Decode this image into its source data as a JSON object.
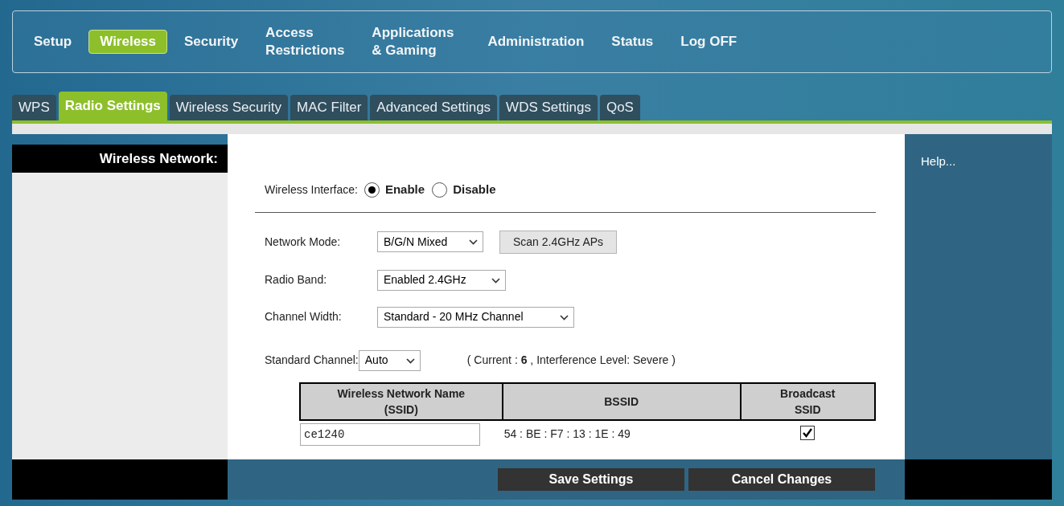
{
  "main_nav": [
    {
      "label": "Setup",
      "selected": false
    },
    {
      "label": "Wireless",
      "selected": true
    },
    {
      "label": "Security",
      "selected": false
    },
    {
      "label": "Access\nRestrictions",
      "selected": false
    },
    {
      "label": "Applications\n& Gaming",
      "selected": false
    },
    {
      "label": "Administration",
      "selected": false
    },
    {
      "label": "Status",
      "selected": false
    },
    {
      "label": "Log OFF",
      "selected": false
    }
  ],
  "sub_tabs": [
    {
      "label": "WPS",
      "selected": false
    },
    {
      "label": "Radio Settings",
      "selected": true
    },
    {
      "label": "Wireless Security",
      "selected": false
    },
    {
      "label": "MAC Filter",
      "selected": false
    },
    {
      "label": "Advanced Settings",
      "selected": false
    },
    {
      "label": "WDS Settings",
      "selected": false
    },
    {
      "label": "QoS",
      "selected": false
    }
  ],
  "section_title": "Wireless Network:",
  "help_link": "Help...",
  "wireless_interface": {
    "label": "Wireless Interface:",
    "options": [
      {
        "label": "Enable",
        "selected": true
      },
      {
        "label": "Disable",
        "selected": false
      }
    ]
  },
  "network_mode": {
    "label": "Network Mode:",
    "value": "B/G/N Mixed",
    "scan_button": "Scan 2.4GHz APs"
  },
  "radio_band": {
    "label": "Radio Band:",
    "value": "Enabled 2.4GHz"
  },
  "channel_width": {
    "label": "Channel Width:",
    "value": "Standard - 20 MHz Channel"
  },
  "standard_channel": {
    "label": "Standard Channel:",
    "value": "Auto",
    "status": "( Current :  **6** , Interference Level: Severe )"
  },
  "ssid_table": {
    "columns": [
      "Wireless Network Name\n(SSID)",
      "BSSID",
      "Broadcast\nSSID"
    ],
    "rows": [
      {
        "ssid": "ce1240",
        "bssid": "54 : BE : F7 : 13 : 1E : 49",
        "broadcast": true
      }
    ]
  },
  "buttons": [
    "Save Settings",
    "Cancel Changes"
  ]
}
